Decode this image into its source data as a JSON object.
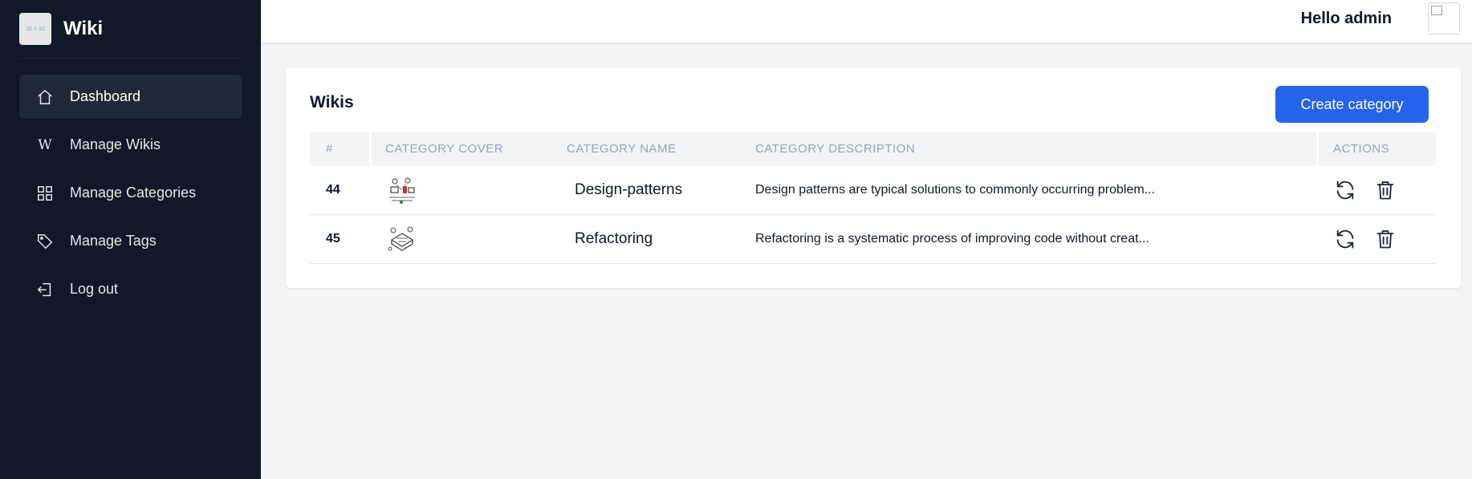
{
  "sidebar": {
    "logo_text": "32 × 32",
    "brand": "Wiki",
    "items": [
      {
        "label": "Dashboard",
        "icon": "home-icon",
        "active": true
      },
      {
        "label": "Manage Wikis",
        "icon": "wikipedia-w-icon"
      },
      {
        "label": "Manage Categories",
        "icon": "grid-icon"
      },
      {
        "label": "Manage Tags",
        "icon": "tag-icon"
      },
      {
        "label": "Log out",
        "icon": "logout-icon"
      }
    ]
  },
  "header": {
    "greeting": "Hello admin",
    "avatar_icon": "broken-image-icon"
  },
  "main": {
    "title": "Wikis",
    "create_button": "Create category",
    "table": {
      "columns": [
        "#",
        "Category cover",
        "Category name",
        "Category description",
        "Actions"
      ],
      "rows": [
        {
          "id": "44",
          "cover": "design-patterns-cover-image",
          "name": "Design-patterns",
          "description": "Design patterns are typical solutions to commonly occurring problem..."
        },
        {
          "id": "45",
          "cover": "refactoring-cover-image",
          "name": "Refactoring",
          "description": "Refactoring is a systematic process of improving code without creat..."
        }
      ],
      "action_icons": [
        "refresh-icon",
        "trash-icon"
      ]
    }
  },
  "colors": {
    "sidebar_bg": "#111827",
    "active_item_bg": "#1f2937",
    "primary": "#2563eb",
    "page_bg": "#f3f4f6"
  }
}
